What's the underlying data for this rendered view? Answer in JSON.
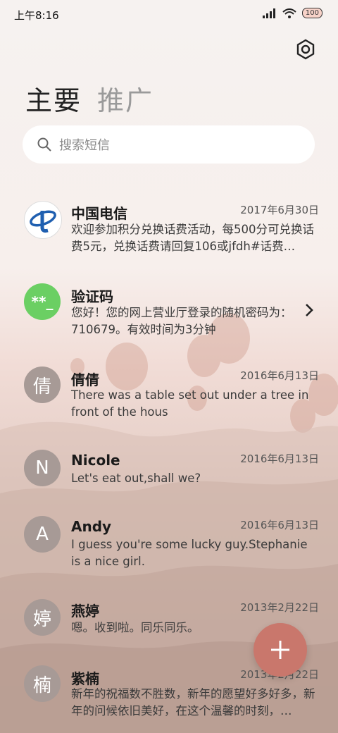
{
  "status_bar": {
    "time": "上午8:16",
    "battery": "100"
  },
  "header": {
    "tabs": [
      {
        "label": "主要",
        "active": true
      },
      {
        "label": "推广",
        "active": false
      }
    ]
  },
  "search": {
    "placeholder": "搜索短信",
    "icon": "search-icon"
  },
  "conversations": [
    {
      "name": "中国电信",
      "avatar_type": "logo",
      "date": "2017年6月30日",
      "preview": "欢迎参加积分兑换话费活动，每500分可兑换话费5元，兑换话费请回复106或jfdh#话费…"
    },
    {
      "name": "验证码",
      "avatar_text": "**_",
      "avatar_color": "#6bcf63",
      "date": "",
      "preview": "您好！您的网上营业厅登录的随机密码为：710679。有效时间为3分钟",
      "chevron": true
    },
    {
      "name": "倩倩",
      "avatar_text": "倩",
      "avatar_color": "#a89b98",
      "date": "2016年6月13日",
      "preview": "There was a table set out under a tree in front of the hous"
    },
    {
      "name": "Nicole",
      "avatar_text": "N",
      "avatar_color": "#a89b98",
      "date": "2016年6月13日",
      "preview": "Let's eat out,shall we?"
    },
    {
      "name": "Andy",
      "avatar_text": "A",
      "avatar_color": "#a89b98",
      "date": "2016年6月13日",
      "preview": "I guess you're some lucky guy.Stephanie is a nice girl."
    },
    {
      "name": "燕婷",
      "avatar_text": "婷",
      "avatar_color": "#a89b98",
      "date": "2013年2月22日",
      "preview": "嗯。收到啦。同乐同乐。"
    },
    {
      "name": "紫楠",
      "avatar_text": "楠",
      "avatar_color": "#a89b98",
      "date": "2013年2月22日",
      "preview": "新年的祝福数不胜数，新年的愿望好多好多，新年的问候依旧美好，在这个温馨的时刻，…"
    }
  ],
  "fab": {
    "icon": "plus-icon",
    "color": "#c9776c"
  }
}
